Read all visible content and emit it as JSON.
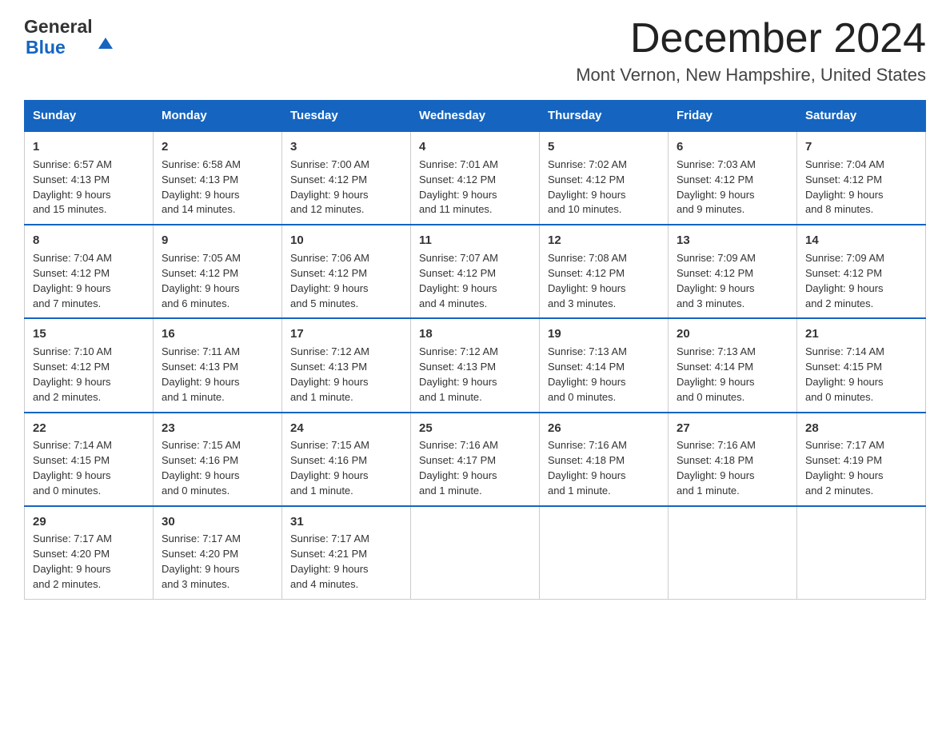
{
  "header": {
    "month_title": "December 2024",
    "location": "Mont Vernon, New Hampshire, United States",
    "logo_general": "General",
    "logo_blue": "Blue"
  },
  "days_of_week": [
    "Sunday",
    "Monday",
    "Tuesday",
    "Wednesday",
    "Thursday",
    "Friday",
    "Saturday"
  ],
  "weeks": [
    [
      {
        "day": "1",
        "sunrise": "6:57 AM",
        "sunset": "4:13 PM",
        "daylight": "9 hours and 15 minutes."
      },
      {
        "day": "2",
        "sunrise": "6:58 AM",
        "sunset": "4:13 PM",
        "daylight": "9 hours and 14 minutes."
      },
      {
        "day": "3",
        "sunrise": "7:00 AM",
        "sunset": "4:12 PM",
        "daylight": "9 hours and 12 minutes."
      },
      {
        "day": "4",
        "sunrise": "7:01 AM",
        "sunset": "4:12 PM",
        "daylight": "9 hours and 11 minutes."
      },
      {
        "day": "5",
        "sunrise": "7:02 AM",
        "sunset": "4:12 PM",
        "daylight": "9 hours and 10 minutes."
      },
      {
        "day": "6",
        "sunrise": "7:03 AM",
        "sunset": "4:12 PM",
        "daylight": "9 hours and 9 minutes."
      },
      {
        "day": "7",
        "sunrise": "7:04 AM",
        "sunset": "4:12 PM",
        "daylight": "9 hours and 8 minutes."
      }
    ],
    [
      {
        "day": "8",
        "sunrise": "7:04 AM",
        "sunset": "4:12 PM",
        "daylight": "9 hours and 7 minutes."
      },
      {
        "day": "9",
        "sunrise": "7:05 AM",
        "sunset": "4:12 PM",
        "daylight": "9 hours and 6 minutes."
      },
      {
        "day": "10",
        "sunrise": "7:06 AM",
        "sunset": "4:12 PM",
        "daylight": "9 hours and 5 minutes."
      },
      {
        "day": "11",
        "sunrise": "7:07 AM",
        "sunset": "4:12 PM",
        "daylight": "9 hours and 4 minutes."
      },
      {
        "day": "12",
        "sunrise": "7:08 AM",
        "sunset": "4:12 PM",
        "daylight": "9 hours and 3 minutes."
      },
      {
        "day": "13",
        "sunrise": "7:09 AM",
        "sunset": "4:12 PM",
        "daylight": "9 hours and 3 minutes."
      },
      {
        "day": "14",
        "sunrise": "7:09 AM",
        "sunset": "4:12 PM",
        "daylight": "9 hours and 2 minutes."
      }
    ],
    [
      {
        "day": "15",
        "sunrise": "7:10 AM",
        "sunset": "4:12 PM",
        "daylight": "9 hours and 2 minutes."
      },
      {
        "day": "16",
        "sunrise": "7:11 AM",
        "sunset": "4:13 PM",
        "daylight": "9 hours and 1 minute."
      },
      {
        "day": "17",
        "sunrise": "7:12 AM",
        "sunset": "4:13 PM",
        "daylight": "9 hours and 1 minute."
      },
      {
        "day": "18",
        "sunrise": "7:12 AM",
        "sunset": "4:13 PM",
        "daylight": "9 hours and 1 minute."
      },
      {
        "day": "19",
        "sunrise": "7:13 AM",
        "sunset": "4:14 PM",
        "daylight": "9 hours and 0 minutes."
      },
      {
        "day": "20",
        "sunrise": "7:13 AM",
        "sunset": "4:14 PM",
        "daylight": "9 hours and 0 minutes."
      },
      {
        "day": "21",
        "sunrise": "7:14 AM",
        "sunset": "4:15 PM",
        "daylight": "9 hours and 0 minutes."
      }
    ],
    [
      {
        "day": "22",
        "sunrise": "7:14 AM",
        "sunset": "4:15 PM",
        "daylight": "9 hours and 0 minutes."
      },
      {
        "day": "23",
        "sunrise": "7:15 AM",
        "sunset": "4:16 PM",
        "daylight": "9 hours and 0 minutes."
      },
      {
        "day": "24",
        "sunrise": "7:15 AM",
        "sunset": "4:16 PM",
        "daylight": "9 hours and 1 minute."
      },
      {
        "day": "25",
        "sunrise": "7:16 AM",
        "sunset": "4:17 PM",
        "daylight": "9 hours and 1 minute."
      },
      {
        "day": "26",
        "sunrise": "7:16 AM",
        "sunset": "4:18 PM",
        "daylight": "9 hours and 1 minute."
      },
      {
        "day": "27",
        "sunrise": "7:16 AM",
        "sunset": "4:18 PM",
        "daylight": "9 hours and 1 minute."
      },
      {
        "day": "28",
        "sunrise": "7:17 AM",
        "sunset": "4:19 PM",
        "daylight": "9 hours and 2 minutes."
      }
    ],
    [
      {
        "day": "29",
        "sunrise": "7:17 AM",
        "sunset": "4:20 PM",
        "daylight": "9 hours and 2 minutes."
      },
      {
        "day": "30",
        "sunrise": "7:17 AM",
        "sunset": "4:20 PM",
        "daylight": "9 hours and 3 minutes."
      },
      {
        "day": "31",
        "sunrise": "7:17 AM",
        "sunset": "4:21 PM",
        "daylight": "9 hours and 4 minutes."
      },
      null,
      null,
      null,
      null
    ]
  ],
  "labels": {
    "sunrise": "Sunrise:",
    "sunset": "Sunset:",
    "daylight": "Daylight:"
  }
}
